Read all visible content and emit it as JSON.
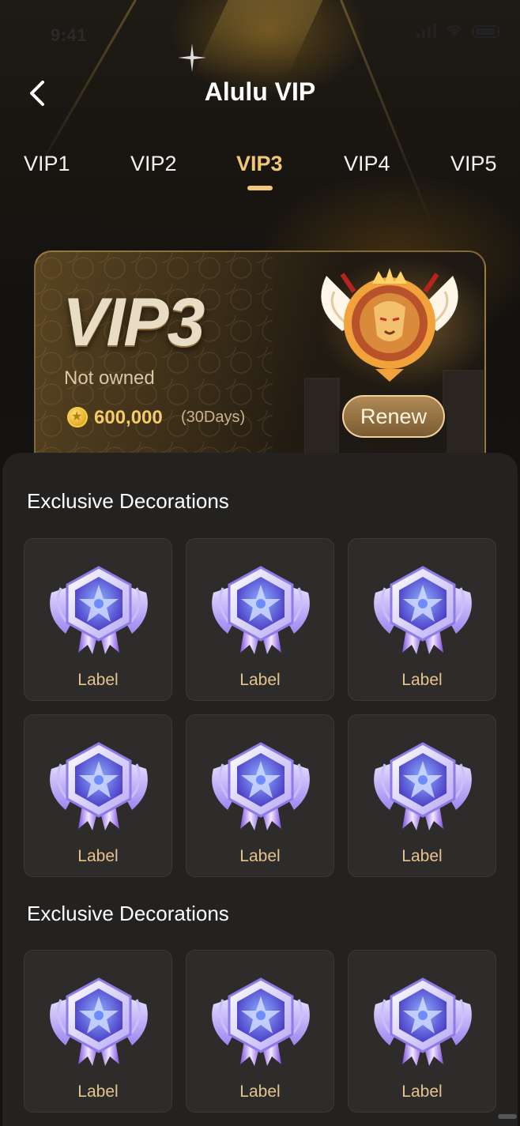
{
  "status_bar": {
    "time": "9:41"
  },
  "header": {
    "title": "Alulu VIP"
  },
  "tabs": [
    {
      "label": "VIP1",
      "active": false
    },
    {
      "label": "VIP2",
      "active": false
    },
    {
      "label": "VIP3",
      "active": true
    },
    {
      "label": "VIP4",
      "active": false
    },
    {
      "label": "VIP5",
      "active": false
    }
  ],
  "vip_card": {
    "level": "VIP3",
    "status": "Not owned",
    "price": "600,000",
    "duration": "(30Days)",
    "renew_label": "Renew"
  },
  "sections": [
    {
      "title": "Exclusive Decorations",
      "items": [
        "Label",
        "Label",
        "Label",
        "Label",
        "Label",
        "Label"
      ]
    },
    {
      "title": "Exclusive Decorations",
      "items": [
        "Label",
        "Label",
        "Label"
      ]
    }
  ],
  "colors": {
    "accent": "#f0c77a",
    "panel": "#232221",
    "background": "#141312",
    "label": "#e6c38d"
  }
}
